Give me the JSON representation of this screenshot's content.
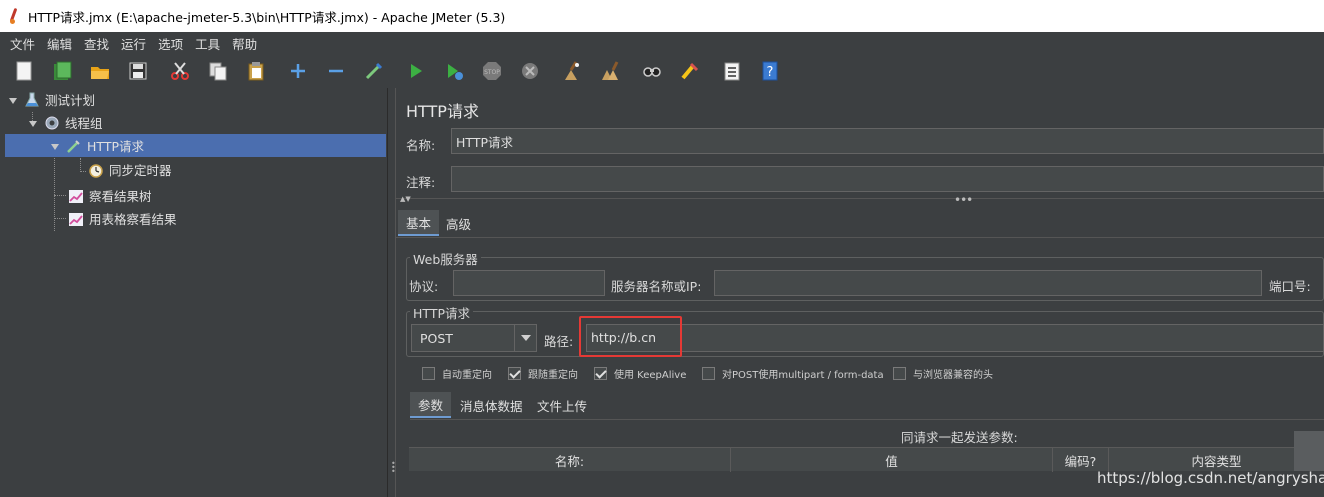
{
  "window": {
    "title": "HTTP请求.jmx (E:\\apache-jmeter-5.3\\bin\\HTTP请求.jmx) - Apache JMeter (5.3)"
  },
  "menu": [
    "文件",
    "编辑",
    "查找",
    "运行",
    "选项",
    "工具",
    "帮助"
  ],
  "toolbar": {
    "icons": [
      "new-icon",
      "templates-icon",
      "open-icon",
      "save-icon",
      "cut-icon",
      "copy-icon",
      "paste-icon",
      "expand-icon",
      "collapse-icon",
      "toggle-icon",
      "start-icon",
      "start-no-pause-icon",
      "stop-icon",
      "shutdown-icon",
      "clear-icon",
      "clear-all-icon",
      "search-icon",
      "reset-search-icon",
      "function-helper-icon",
      "help-icon"
    ]
  },
  "tree": {
    "items": [
      {
        "label": "测试计划"
      },
      {
        "label": "线程组"
      },
      {
        "label": "HTTP请求"
      },
      {
        "label": "同步定时器"
      },
      {
        "label": "察看结果树"
      },
      {
        "label": "用表格察看结果"
      }
    ]
  },
  "editor": {
    "title": "HTTP请求",
    "name_label": "名称:",
    "name_value": "HTTP请求",
    "comment_label": "注释:",
    "comment_value": "",
    "tabs": [
      "基本",
      "高级"
    ],
    "web_server": {
      "group_title": "Web服务器",
      "protocol_label": "协议:",
      "protocol_value": "",
      "server_label": "服务器名称或IP:",
      "server_value": "",
      "port_label": "端口号:"
    },
    "http_request": {
      "group_title": "HTTP请求",
      "method": "POST",
      "path_label": "路径:",
      "path_value": "http://b.cn"
    },
    "options": [
      {
        "label": "自动重定向",
        "checked": false
      },
      {
        "label": "跟随重定向",
        "checked": true
      },
      {
        "label": "使用 KeepAlive",
        "checked": true
      },
      {
        "label": "对POST使用multipart / form-data",
        "checked": false
      },
      {
        "label": "与浏览器兼容的头",
        "checked": false
      }
    ],
    "sub_tabs": [
      "参数",
      "消息体数据",
      "文件上传"
    ],
    "params_caption": "同请求一起发送参数:",
    "table_headers": [
      "名称:",
      "值",
      "编码?",
      "内容类型"
    ]
  },
  "watermark": "https://blog.csdn.net/angryshan"
}
